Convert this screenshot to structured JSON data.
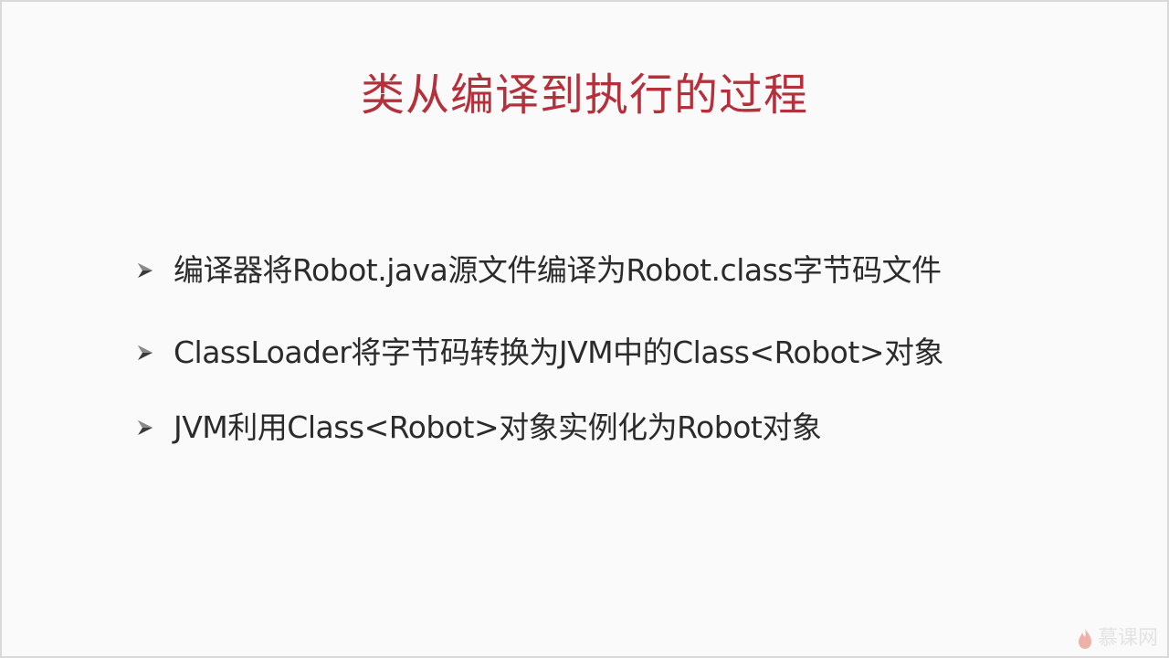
{
  "slide": {
    "title": "类从编译到执行的过程",
    "bullets": [
      {
        "icon": "arrow-bullet-icon",
        "text": "编译器将Robot.java源文件编译为Robot.class字节码文件"
      },
      {
        "icon": "arrow-bullet-icon",
        "text": "ClassLoader将字节码转换为JVM中的Class<Robot>对象"
      },
      {
        "icon": "arrow-bullet-icon",
        "text": "JVM利用Class<Robot>对象实例化为Robot对象"
      }
    ]
  },
  "watermark": {
    "icon": "flame-icon",
    "text": "慕课网"
  },
  "colors": {
    "title": "#b5303b",
    "body_text": "#2b2b2b",
    "background": "#fafafa"
  }
}
